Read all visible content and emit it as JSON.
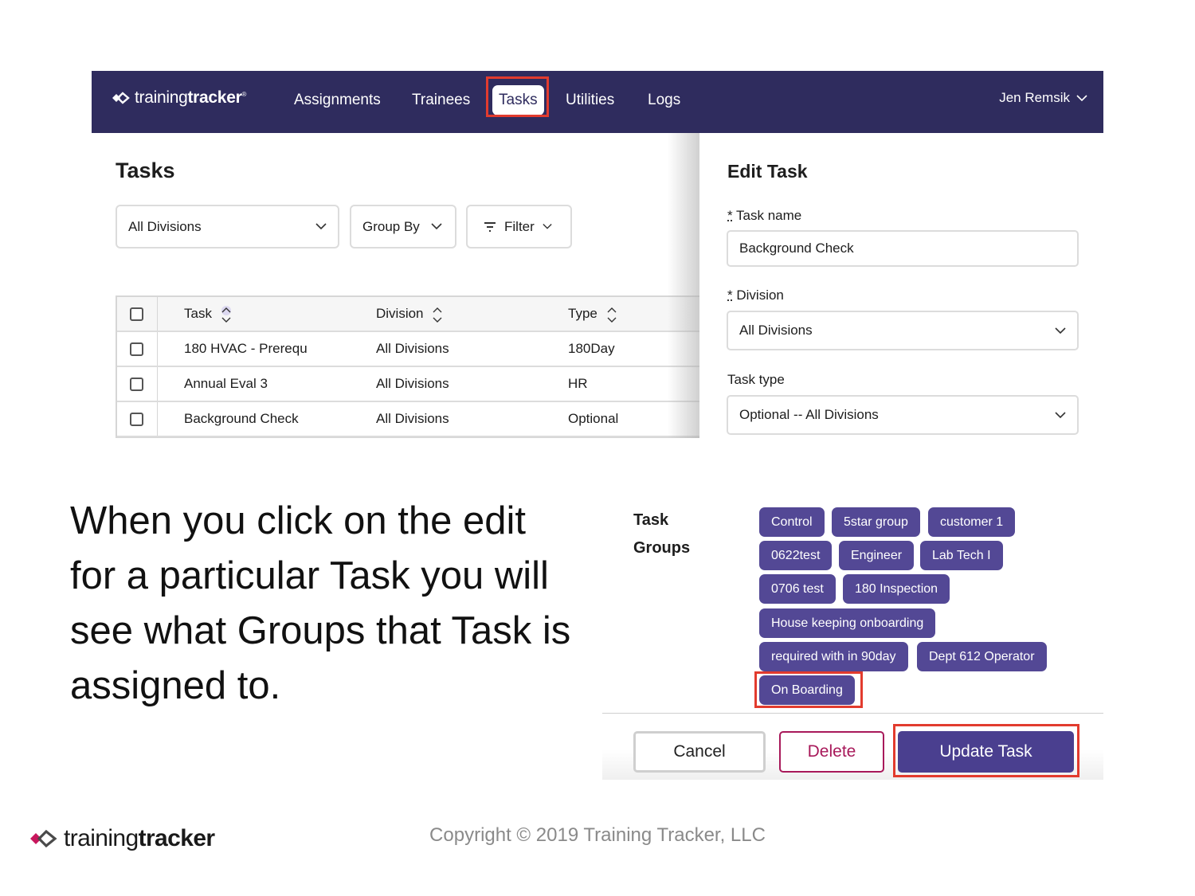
{
  "app": {
    "brand_light": "training",
    "brand_bold": "tracker",
    "brand_reg": "®",
    "brand_color": "#2f2c5e",
    "accent_color": "#534895",
    "highlight_color": "#e23b2e"
  },
  "nav": {
    "items": [
      "Assignments",
      "Trainees",
      "Tasks",
      "Utilities",
      "Logs"
    ],
    "active": "Tasks",
    "user": "Jen Remsik"
  },
  "tasks_page": {
    "title": "Tasks",
    "division_select": "All Divisions",
    "group_by": "Group By",
    "filter": "Filter",
    "columns": [
      "Task",
      "Division",
      "Type"
    ],
    "rows": [
      [
        "180 HVAC - Prerequ",
        "All Divisions",
        "180Day"
      ],
      [
        "Annual Eval 3",
        "All Divisions",
        "HR"
      ],
      [
        "Background Check",
        "All Divisions",
        "Optional"
      ]
    ]
  },
  "edit_task": {
    "title": "Edit Task",
    "required_mark": "*",
    "task_name_label": "Task name",
    "task_name_value": "Background Check",
    "division_label": "Division",
    "division_value": "All Divisions",
    "task_type_label": "Task type",
    "task_type_value": "Optional -- All Divisions",
    "groups_label_1": "Task",
    "groups_label_2": "Groups",
    "groups": [
      "Control",
      "5star group",
      "customer 1",
      "0622test",
      "Engineer",
      "Lab Tech I",
      "0706 test",
      "180 Inspection",
      "House keeping onboarding",
      "required with in 90day",
      "Dept 612 Operator",
      "On Boarding"
    ],
    "highlighted_group": "On Boarding",
    "cancel": "Cancel",
    "delete": "Delete",
    "update": "Update Task"
  },
  "caption": "When you click on the edit for a particular Task you will see what Groups that Task is assigned to.",
  "footer": {
    "brand_light": "training",
    "brand_bold": "tracker",
    "copyright": "Copyright © 2019 Training Tracker, LLC"
  }
}
